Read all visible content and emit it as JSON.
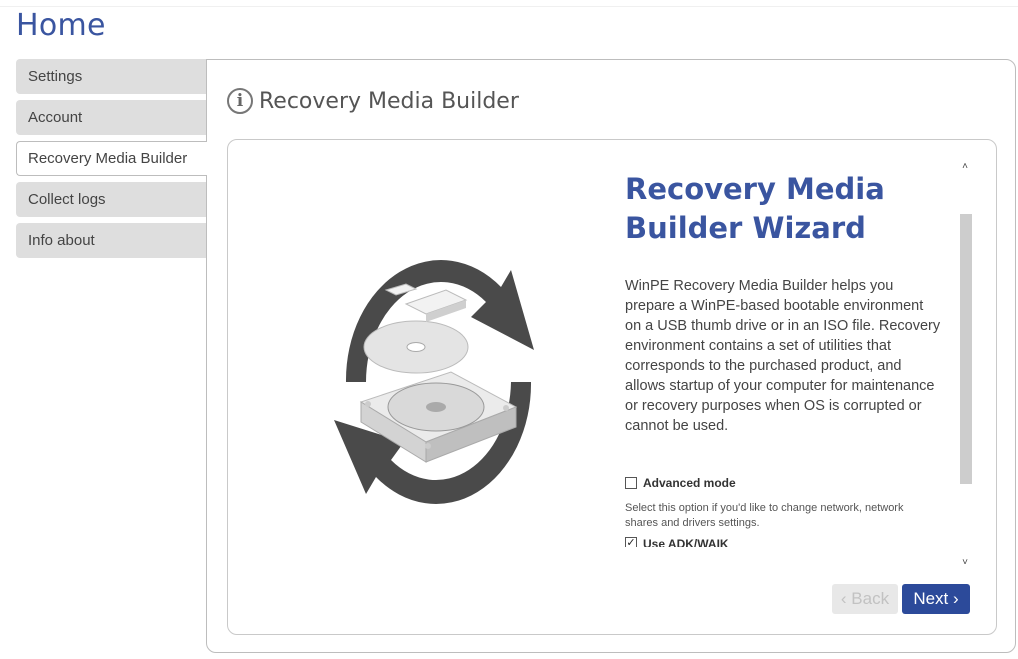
{
  "page": {
    "title": "Home"
  },
  "sidebar": {
    "items": [
      {
        "label": "Settings",
        "active": false
      },
      {
        "label": "Account",
        "active": false
      },
      {
        "label": "Recovery Media Builder",
        "active": true
      },
      {
        "label": "Collect logs",
        "active": false
      },
      {
        "label": "Info about",
        "active": false
      }
    ]
  },
  "section": {
    "title": "Recovery Media Builder",
    "icon": "info-icon"
  },
  "wizard": {
    "heading": "Recovery Media Builder Wizard",
    "description": "WinPE Recovery Media Builder helps you prepare a WinPE-based bootable environment on a USB thumb drive or in an ISO file. Recovery environment contains a set of utilities that corresponds to the purchased product, and allows startup of your computer for maintenance or recovery purposes when OS is corrupted or cannot be used.",
    "options": [
      {
        "label": "Advanced mode",
        "checked": false,
        "description": "Select this option if you'd like to change network, network shares and drivers settings."
      },
      {
        "label": "Use ADK/WAIK",
        "checked": true
      }
    ],
    "buttons": {
      "back": "‹ Back",
      "next": "Next ›"
    }
  },
  "colors": {
    "accent": "#3a55a0",
    "next_button": "#2c4a9a",
    "sidebar_bg": "#dedede"
  }
}
